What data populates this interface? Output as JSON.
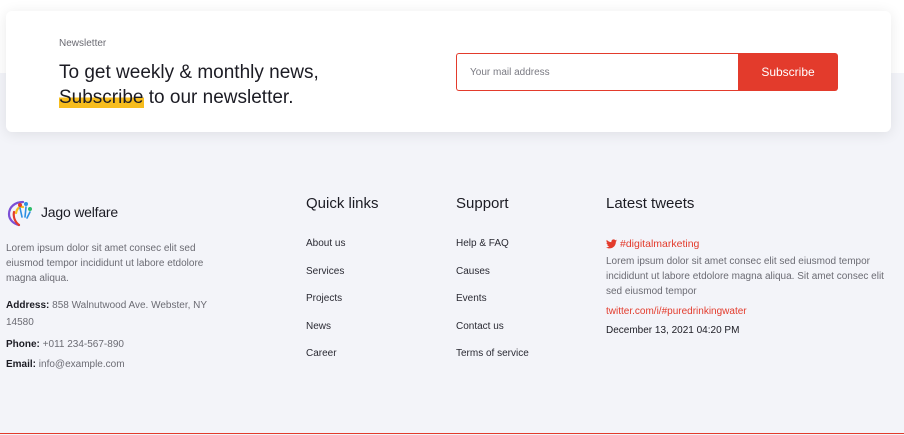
{
  "newsletter": {
    "eyebrow": "Newsletter",
    "heading_line1": "To get weekly & monthly news,",
    "heading_highlight": "Subscribe",
    "heading_rest": " to our newsletter.",
    "input_placeholder": "Your mail address",
    "button_label": "Subscribe"
  },
  "brand": {
    "name": "Jago welfare",
    "description": "Lorem ipsum dolor sit amet consec elit sed eiusmod tempor incididunt ut labore etdolore magna aliqua.",
    "address_label": "Address:",
    "address_value": "858 Walnutwood Ave. Webster, NY 14580",
    "phone_label": "Phone:",
    "phone_value": "+011 234-567-890",
    "email_label": "Email:",
    "email_value": "info@example.com"
  },
  "quick_links": {
    "title": "Quick links",
    "items": [
      "About us",
      "Services",
      "Projects",
      "News",
      "Career"
    ]
  },
  "support": {
    "title": "Support",
    "items": [
      "Help & FAQ",
      "Causes",
      "Events",
      "Contact us",
      "Terms of service"
    ]
  },
  "tweets": {
    "title": "Latest tweets",
    "hashtag": "#digitalmarketing",
    "text": "Lorem ipsum dolor sit amet consec elit sed eiusmod tempor incididunt ut labore etdolore magna aliqua. Sit amet consec elit sed eiusmod tempor",
    "link": "twitter.com/i/#puredrinkingwater",
    "date": "December 13, 2021 04:20 PM"
  },
  "colors": {
    "accent": "#e33b2c",
    "highlight": "#f7bd1e",
    "background": "#f3f4f9"
  },
  "icons": {
    "logo": "logo-icon",
    "twitter": "twitter-icon"
  }
}
